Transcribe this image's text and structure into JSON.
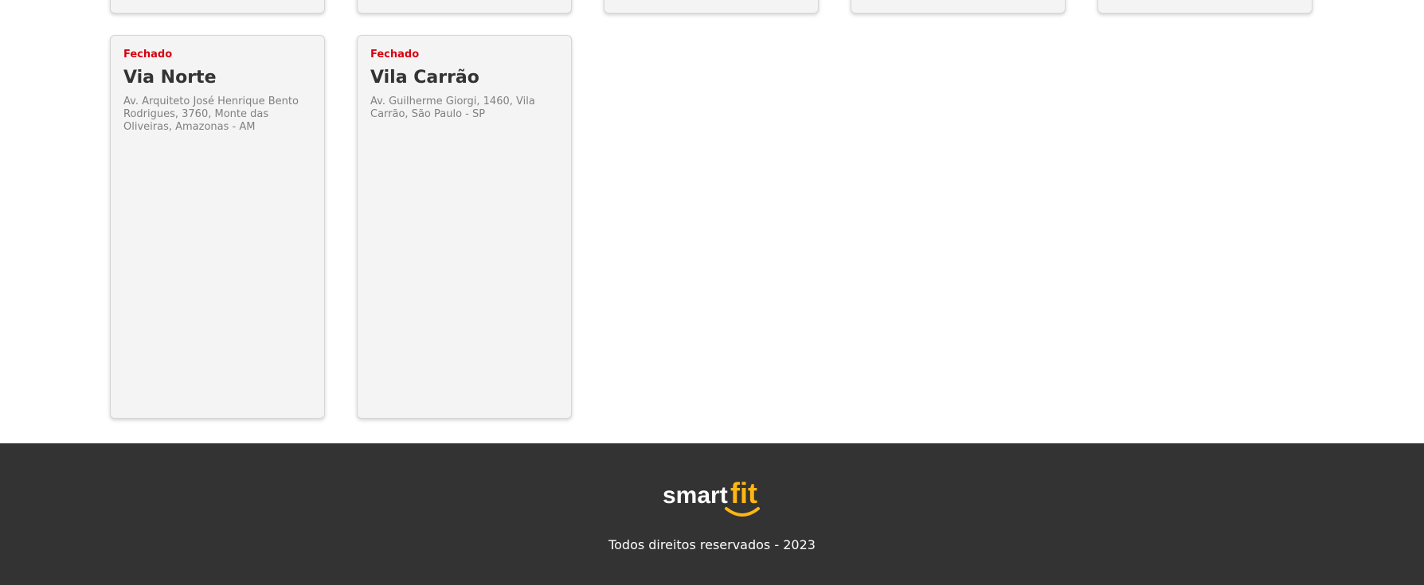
{
  "cards": [
    {
      "status": "Fechado",
      "title": "Via Norte",
      "address": "Av. Arquiteto José Henrique Bento Rodrigues, 3760, Monte das Oliveiras, Amazonas - AM"
    },
    {
      "status": "Fechado",
      "title": "Vila Carrão",
      "address": "Av. Guilherme Giorgi, 1460, Vila Carrão, São Paulo - SP"
    }
  ],
  "footer": {
    "logo_part1": "smart",
    "logo_part2": "fit",
    "copyright": "Todos direitos reservados - 2023"
  },
  "colors": {
    "status_red": "#d7000f",
    "footer_bg": "#333333",
    "logo_yellow": "#ffb612"
  }
}
